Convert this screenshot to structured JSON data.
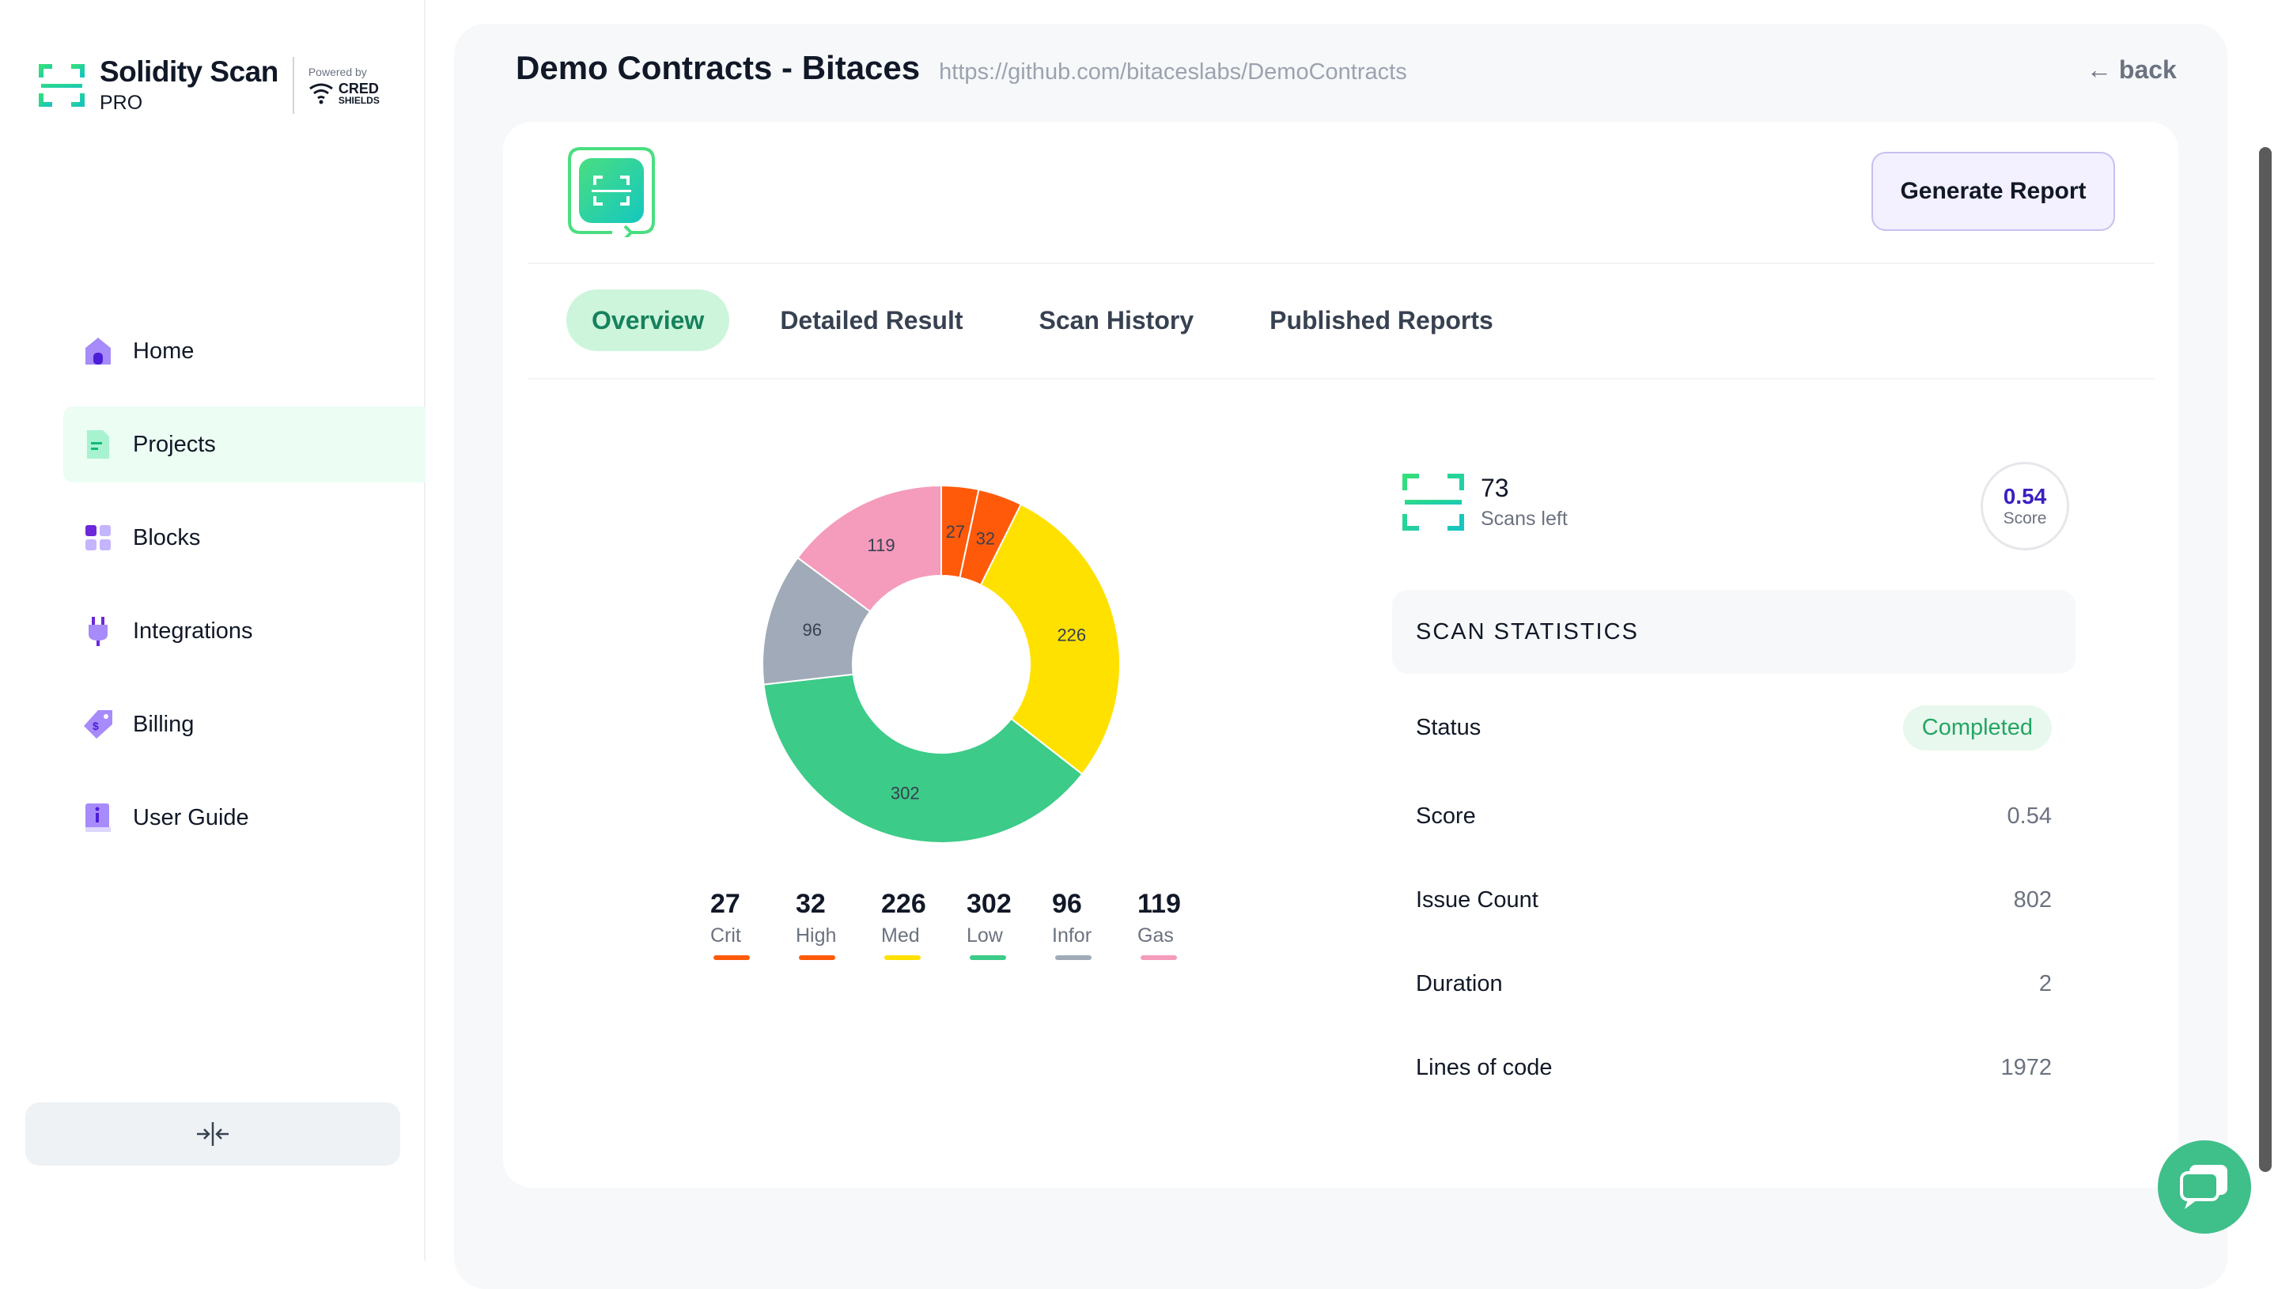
{
  "brand": {
    "title": "Solidity Scan",
    "tier": "PRO",
    "powered_by": "Powered by",
    "partner_line1": "CRED",
    "partner_line2": "SHIELDS"
  },
  "nav": [
    {
      "label": "Home",
      "icon": "home-icon"
    },
    {
      "label": "Projects",
      "icon": "document-icon",
      "active": true
    },
    {
      "label": "Blocks",
      "icon": "blocks-icon"
    },
    {
      "label": "Integrations",
      "icon": "plug-icon"
    },
    {
      "label": "Billing",
      "icon": "tag-icon"
    },
    {
      "label": "User Guide",
      "icon": "book-icon"
    }
  ],
  "header": {
    "title": "Demo Contracts - Bitaces",
    "repo": "https://github.com/bitaceslabs/DemoContracts",
    "back": "← back"
  },
  "actions": {
    "generate_report": "Generate Report"
  },
  "tabs": [
    {
      "label": "Overview",
      "active": true
    },
    {
      "label": "Detailed Result"
    },
    {
      "label": "Scan History"
    },
    {
      "label": "Published Reports"
    }
  ],
  "chart_data": {
    "type": "pie",
    "categories": [
      "Crit",
      "High",
      "Med",
      "Low",
      "Infor",
      "Gas"
    ],
    "values": [
      27,
      32,
      226,
      302,
      96,
      119
    ],
    "colors": [
      "#ff5a0a",
      "#ff5a0a",
      "#ffe100",
      "#3ccb88",
      "#a0aab8",
      "#f59bbb"
    ]
  },
  "scans": {
    "count": "73",
    "label": "Scans left"
  },
  "score_badge": {
    "value": "0.54",
    "label": "Score"
  },
  "stats": {
    "heading": "SCAN STATISTICS",
    "status_label": "Status",
    "status_value": "Completed",
    "rows": [
      {
        "key": "Score",
        "value": "0.54"
      },
      {
        "key": "Issue Count",
        "value": "802"
      },
      {
        "key": "Duration",
        "value": "2"
      },
      {
        "key": "Lines of code",
        "value": "1972"
      }
    ]
  }
}
